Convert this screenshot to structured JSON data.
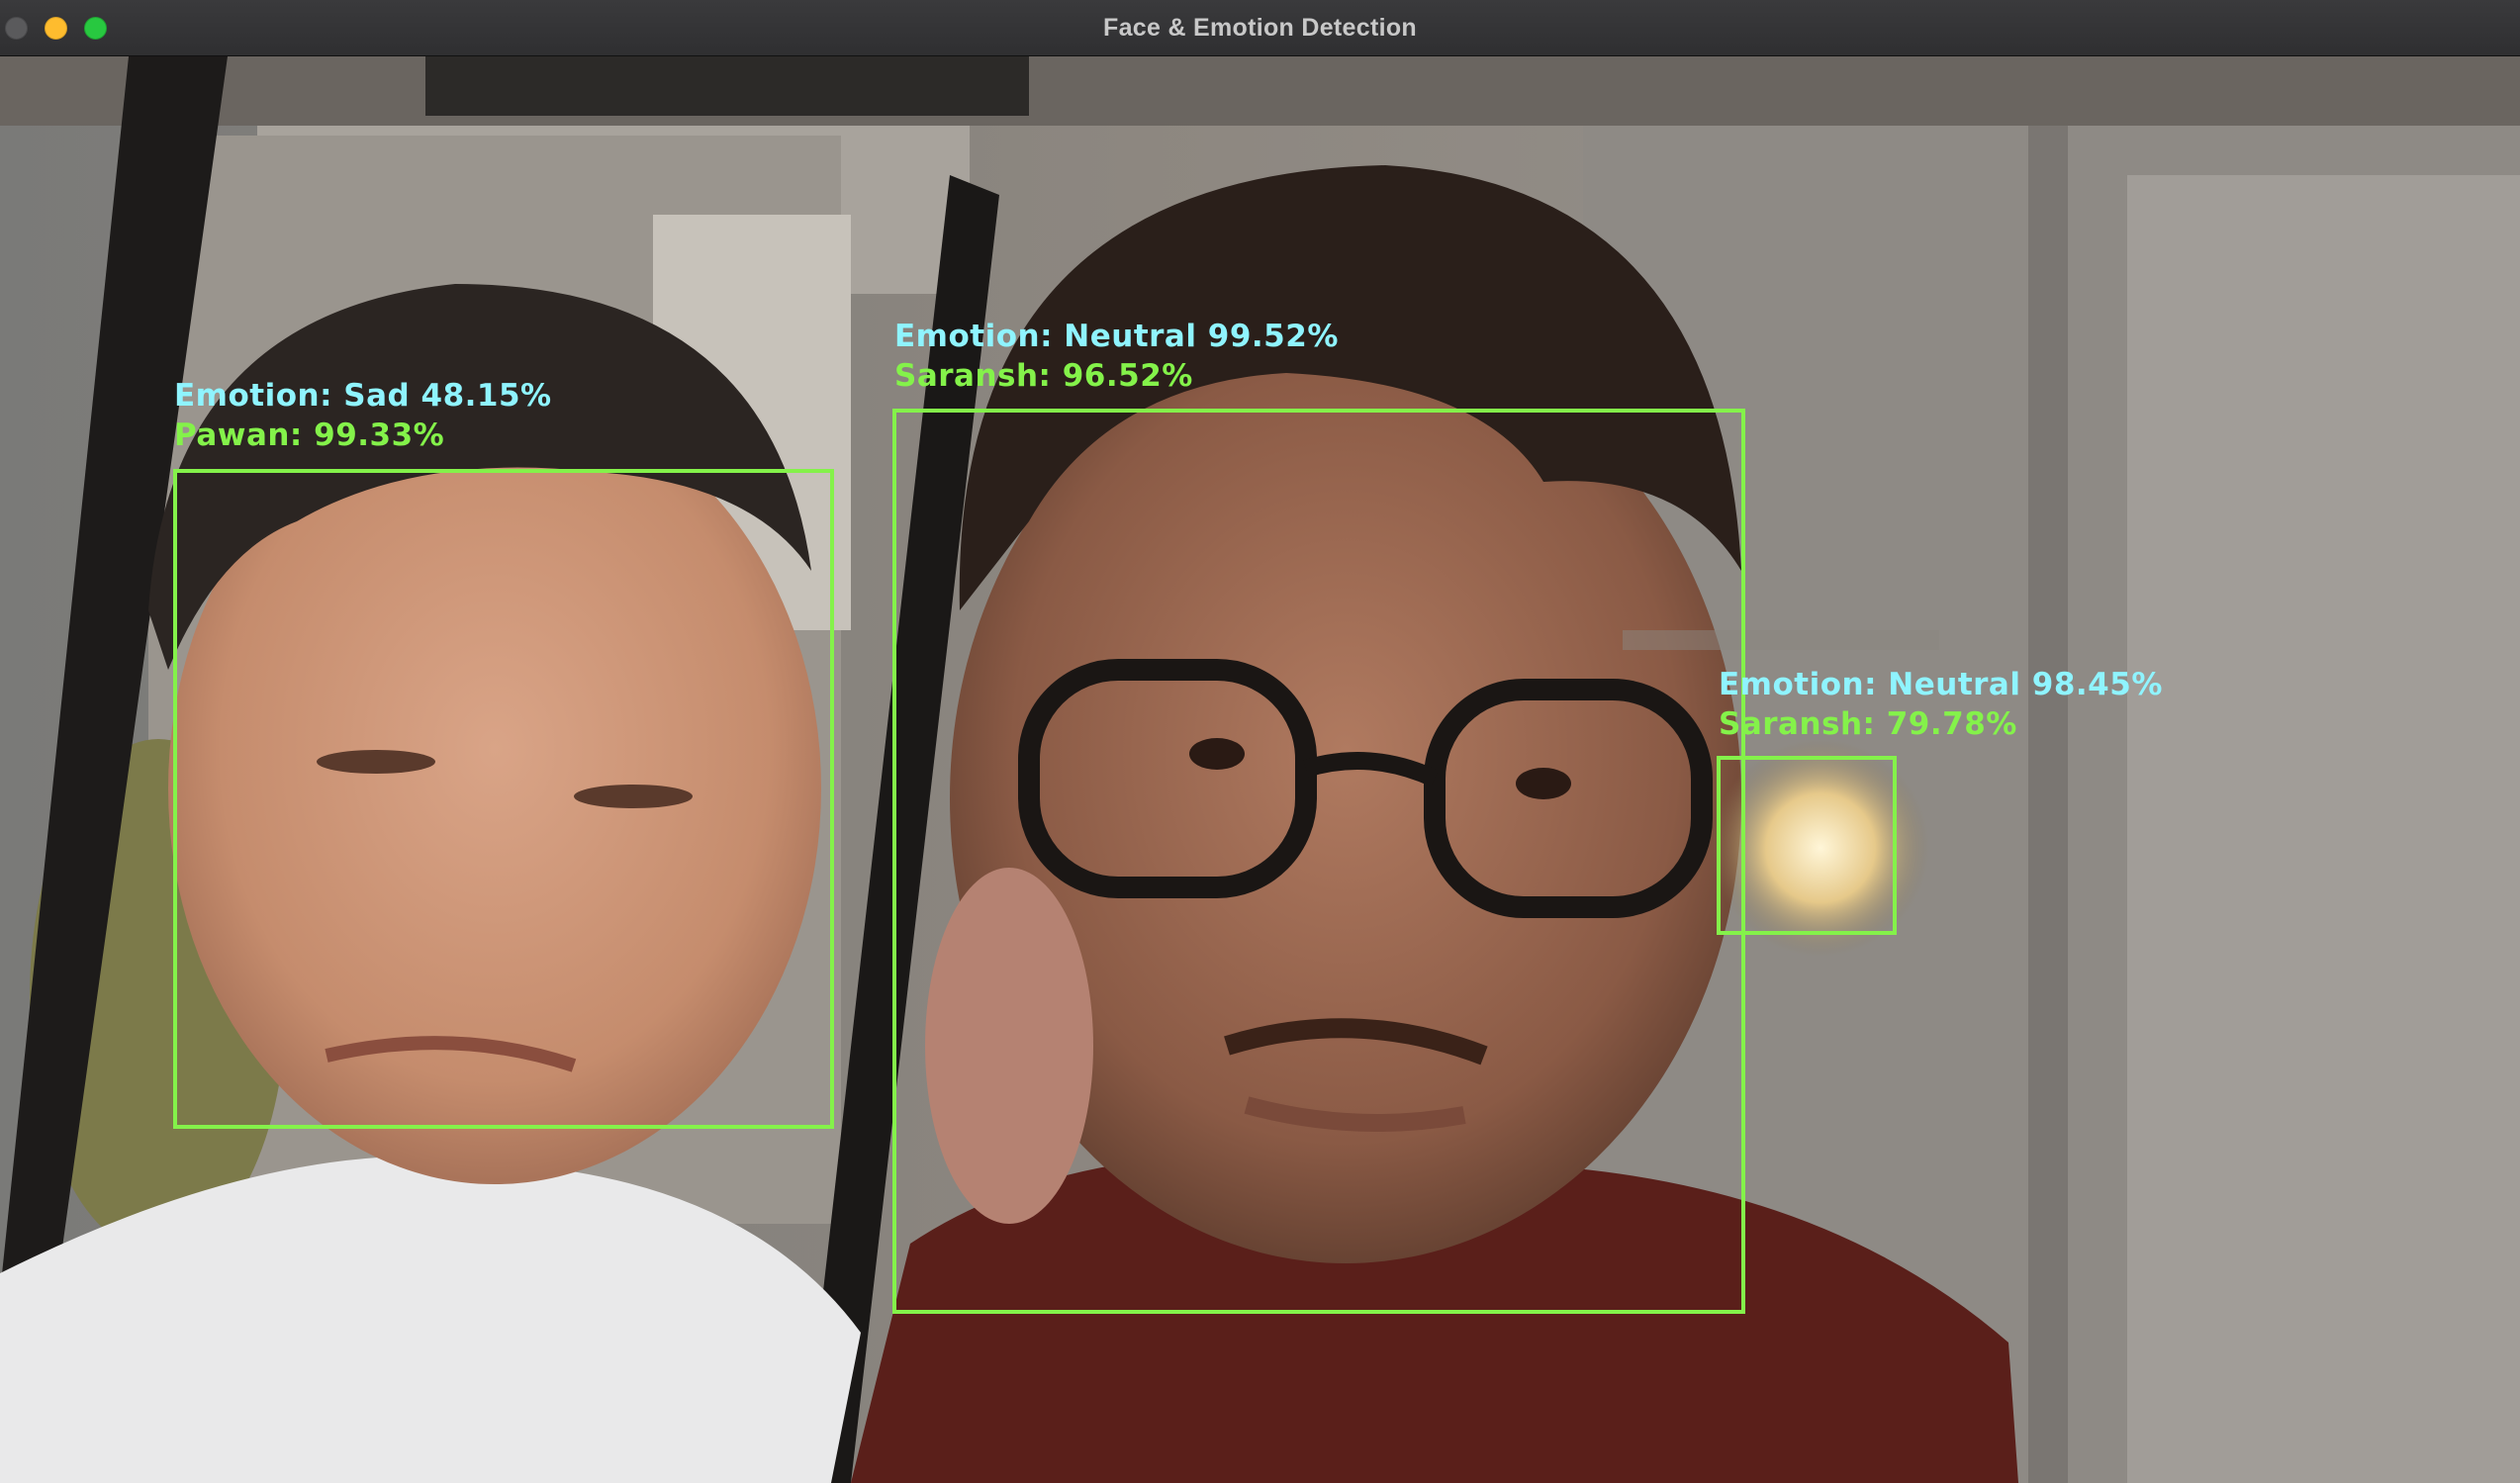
{
  "window": {
    "title": "Face & Emotion Detection"
  },
  "detections": [
    {
      "emotion_label": "Emotion: Sad 48.15%",
      "name_label": "Pawan: 99.33%"
    },
    {
      "emotion_label": "Emotion: Neutral 99.52%",
      "name_label": "Saransh: 96.52%"
    },
    {
      "emotion_label": "Emotion: Neutral 98.45%",
      "name_label": "Saransh: 79.78%"
    }
  ],
  "colors": {
    "box": "#84f24a",
    "emotion_text": "#8ff4ff",
    "name_text": "#84f24a"
  }
}
